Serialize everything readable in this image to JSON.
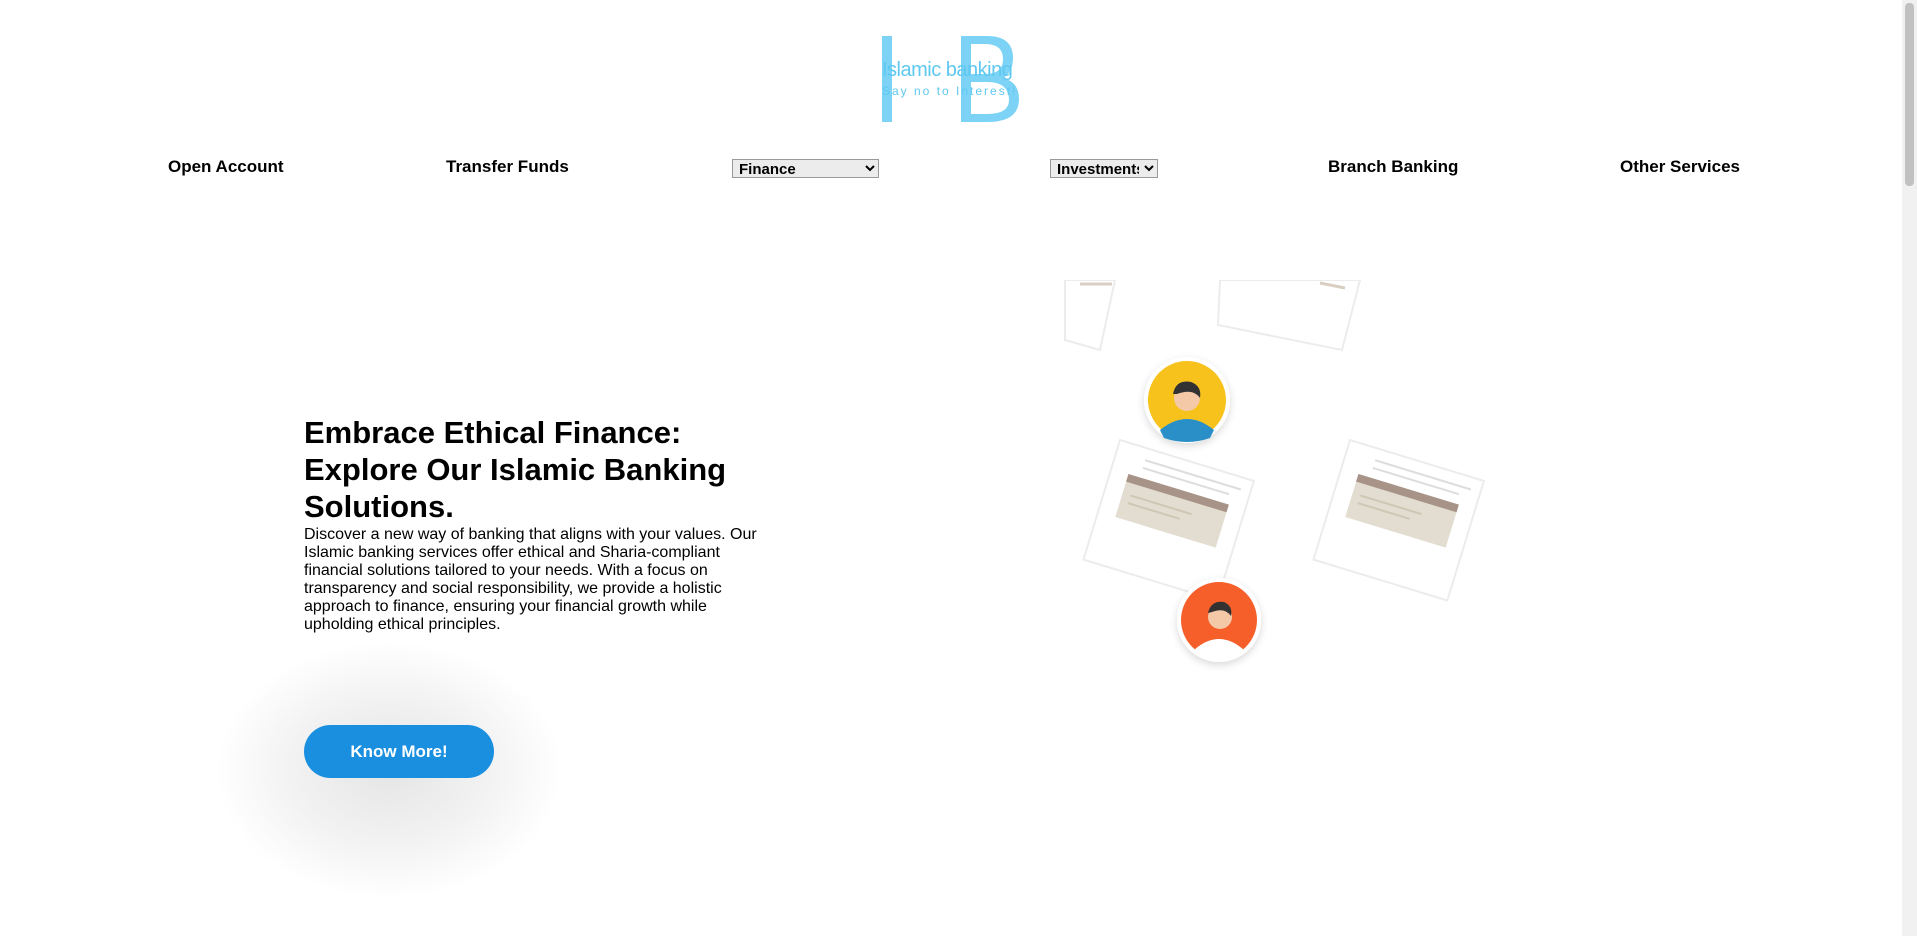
{
  "logo": {
    "title": "Islamic banking",
    "tagline": "Say no to Interest!"
  },
  "nav": {
    "open_account": "Open Account",
    "transfer_funds": "Transfer Funds",
    "finance_select": {
      "selected": "Finance"
    },
    "investments_select": {
      "selected": "Investments"
    },
    "branch_banking": "Branch Banking",
    "other_services": "Other Services"
  },
  "hero": {
    "title": "Embrace Ethical Finance: Explore Our Islamic Banking Solutions.",
    "description": "Discover a new way of banking that aligns with your values. Our Islamic banking services offer ethical and Sharia-compliant financial solutions tailored to your needs. With a focus on transparency and social responsibility, we provide a holistic approach to finance, ensuring your financial growth while upholding ethical principles.",
    "cta_label": "Know More!"
  },
  "colors": {
    "logo": "#7dd3f5",
    "cta": "#1a8fe0",
    "avatar_yellow": "#f7c21b",
    "avatar_orange": "#f65f2a"
  },
  "illustration": {
    "icons": [
      "document-card-icon",
      "user-avatar-icon"
    ]
  }
}
